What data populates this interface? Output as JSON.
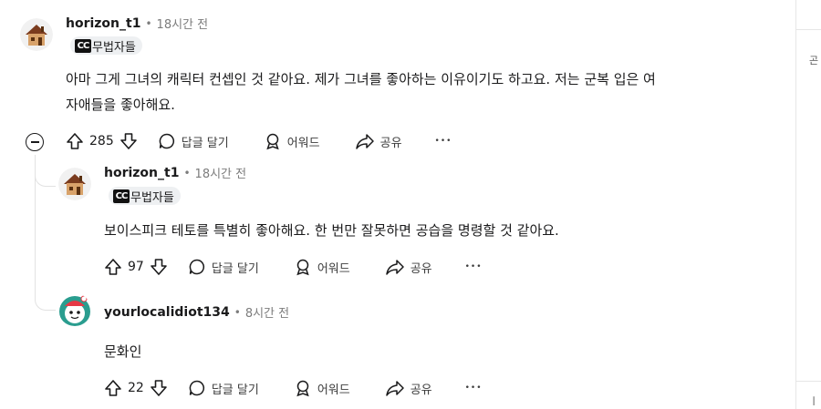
{
  "comments": [
    {
      "username": "horizon_t1",
      "separator": "•",
      "time": "18시간 전",
      "flair": "무법자들",
      "flair_emblem": "CC",
      "body_line1": "아마 그게 그녀의 캐릭터 컨셉인 것 같아요. 제가 그녀를 좋아하는 이유이기도 하고요. 저는 군복 입은 여",
      "body_line2": "자애들을 좋아해요.",
      "score": "285",
      "reply_label": "답글 달기",
      "award_label": "어워드",
      "share_label": "공유",
      "more_label": "•••"
    },
    {
      "username": "horizon_t1",
      "separator": "•",
      "time": "18시간 전",
      "flair": "무법자들",
      "flair_emblem": "CC",
      "body_line1": "보이스피크 테토를 특별히 좋아해요. 한 번만 잘못하면 공습을 명령할 것 같아요.",
      "score": "97",
      "reply_label": "답글 달기",
      "award_label": "어워드",
      "share_label": "공유",
      "more_label": "•••"
    },
    {
      "username": "yourlocalidiot134",
      "separator": "•",
      "time": "8시간 전",
      "body_line1": "문화인",
      "score": "22",
      "reply_label": "답글 달기",
      "award_label": "어워드",
      "share_label": "공유",
      "more_label": "•••"
    }
  ],
  "sidebar": {
    "glyph_top": "곤",
    "glyph_bottom": "ㅣ"
  },
  "colors": {
    "meta": "#7c7c7c",
    "text": "#1a1a1b",
    "thread": "#e2e2e2",
    "flair_bg": "#eef0f2"
  }
}
